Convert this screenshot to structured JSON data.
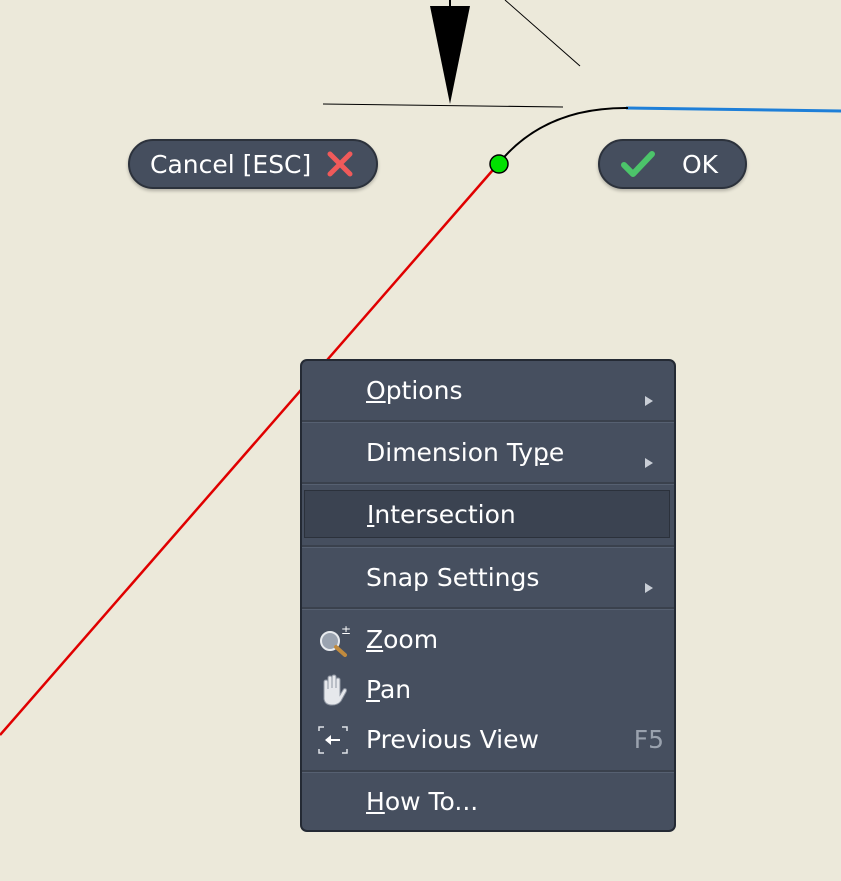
{
  "buttons": {
    "cancel_label": "Cancel [ESC]",
    "ok_label": "OK"
  },
  "context_menu": {
    "items": [
      {
        "label": "Options",
        "mnemonic": "O",
        "rest": "ptions",
        "submenu": true
      },
      {
        "label": "Dimension Type",
        "pre": "Dimension Ty",
        "mnemonic": "p",
        "rest": "e",
        "submenu": true
      },
      {
        "label": "Intersection",
        "mnemonic": "I",
        "rest": "ntersection",
        "submenu": false,
        "highlighted": true
      },
      {
        "label": "Snap Settings",
        "submenu": true
      },
      {
        "label": "Zoom",
        "mnemonic": "Z",
        "rest": "oom",
        "icon": "zoom-icon"
      },
      {
        "label": "Pan",
        "mnemonic": "P",
        "rest": "an",
        "icon": "pan-hand-icon"
      },
      {
        "label": "Previous View",
        "icon": "previous-view-icon",
        "shortcut": "F5"
      },
      {
        "label": "How To...",
        "mnemonic": "H",
        "rest": "ow To..."
      }
    ]
  },
  "colors": {
    "canvas_background": "#ece9da",
    "menu_background": "#464f5f",
    "red_line": "#e00000",
    "blue_line": "#1e7fd8",
    "snap_point": "#00e000",
    "cancel_x": "#f05a5a",
    "ok_check": "#4cc46a"
  }
}
